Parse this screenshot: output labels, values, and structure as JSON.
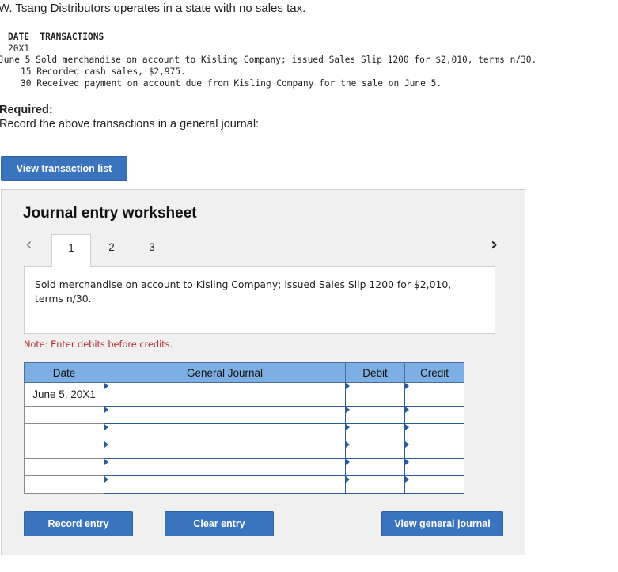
{
  "intro": "W. Tsang Distributors operates in a state with no sales tax.",
  "transactions": {
    "header": "DATE  TRANSACTIONS",
    "year": "20X1",
    "lines": [
      "June 5 Sold merchandise on account to Kisling Company; issued Sales Slip 1200 for $2,010, terms n/30.",
      "15 Recorded cash sales, $2,975.",
      "30 Received payment on account due from Kisling Company for the sale on June 5."
    ]
  },
  "required": {
    "title": "Required:",
    "text": "Record the above transactions in a general journal:"
  },
  "view_transaction_list_label": "View transaction list",
  "worksheet": {
    "title": "Journal entry worksheet",
    "tabs": [
      "1",
      "2",
      "3"
    ],
    "active_tab": "1",
    "prev_icon": "chevron-left-icon",
    "next_icon": "chevron-right-icon",
    "description": "Sold merchandise on account to Kisling Company; issued Sales Slip 1200 for $2,010, terms n/30.",
    "note": "Note: Enter debits before credits.",
    "table": {
      "headers": [
        "Date",
        "General Journal",
        "Debit",
        "Credit"
      ],
      "rows": [
        {
          "date": "June 5, 20X1",
          "account": "",
          "debit": "",
          "credit": ""
        },
        {
          "date": "",
          "account": "",
          "debit": "",
          "credit": ""
        },
        {
          "date": "",
          "account": "",
          "debit": "",
          "credit": ""
        },
        {
          "date": "",
          "account": "",
          "debit": "",
          "credit": ""
        },
        {
          "date": "",
          "account": "",
          "debit": "",
          "credit": ""
        },
        {
          "date": "",
          "account": "",
          "debit": "",
          "credit": ""
        }
      ]
    },
    "buttons": {
      "record": "Record entry",
      "clear": "Clear entry",
      "view_journal": "View general journal"
    }
  },
  "colors": {
    "button": "#3b74be",
    "table_header": "#7daee4",
    "note": "#b22a2a",
    "panel": "#f0f0f0"
  }
}
